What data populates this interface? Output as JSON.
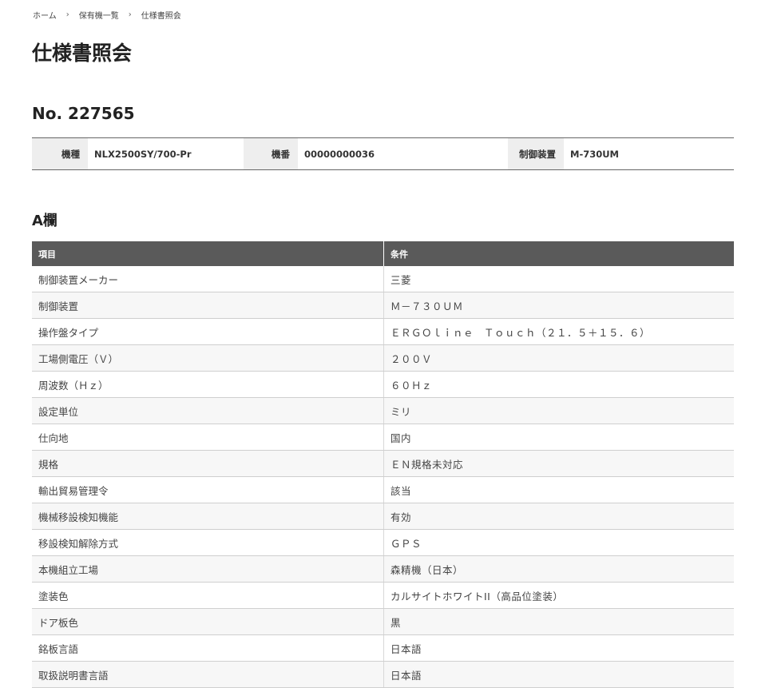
{
  "breadcrumb": {
    "home": "ホーム",
    "list": "保有機一覧",
    "current": "仕様書照会",
    "separator": "›"
  },
  "page_title": "仕様書照会",
  "machine_no": "No. 227565",
  "info": {
    "model_label": "機種",
    "model_value": "NLX2500SY/700-Pr",
    "serial_label": "機番",
    "serial_value": "00000000036",
    "controller_label": "制御装置",
    "controller_value": "M-730UM"
  },
  "section_title": "A欄",
  "table": {
    "headers": [
      "項目",
      "条件"
    ],
    "rows": [
      [
        "制御装置メーカー",
        "三菱"
      ],
      [
        "制御装置",
        "Ｍ－７３０ＵＭ"
      ],
      [
        "操作盤タイプ",
        "ＥＲＧＯｌｉｎｅ　Ｔｏｕｃｈ（２１．５＋１５．６）"
      ],
      [
        "工場側電圧（Ｖ）",
        "２００Ｖ"
      ],
      [
        "周波数（Ｈｚ）",
        "６０Ｈｚ"
      ],
      [
        "設定単位",
        "ミリ"
      ],
      [
        "仕向地",
        "国内"
      ],
      [
        "規格",
        "ＥＮ規格未対応"
      ],
      [
        "輸出貿易管理令",
        "該当"
      ],
      [
        "機械移設検知機能",
        "有効"
      ],
      [
        "移設検知解除方式",
        "ＧＰＳ"
      ],
      [
        "本機組立工場",
        "森精機（日本）"
      ],
      [
        "塗装色",
        "カルサイトホワイトII（高品位塗装）"
      ],
      [
        "ドア板色",
        "黒"
      ],
      [
        "銘板言語",
        "日本語"
      ],
      [
        "取扱説明書言語",
        "日本語"
      ]
    ]
  }
}
